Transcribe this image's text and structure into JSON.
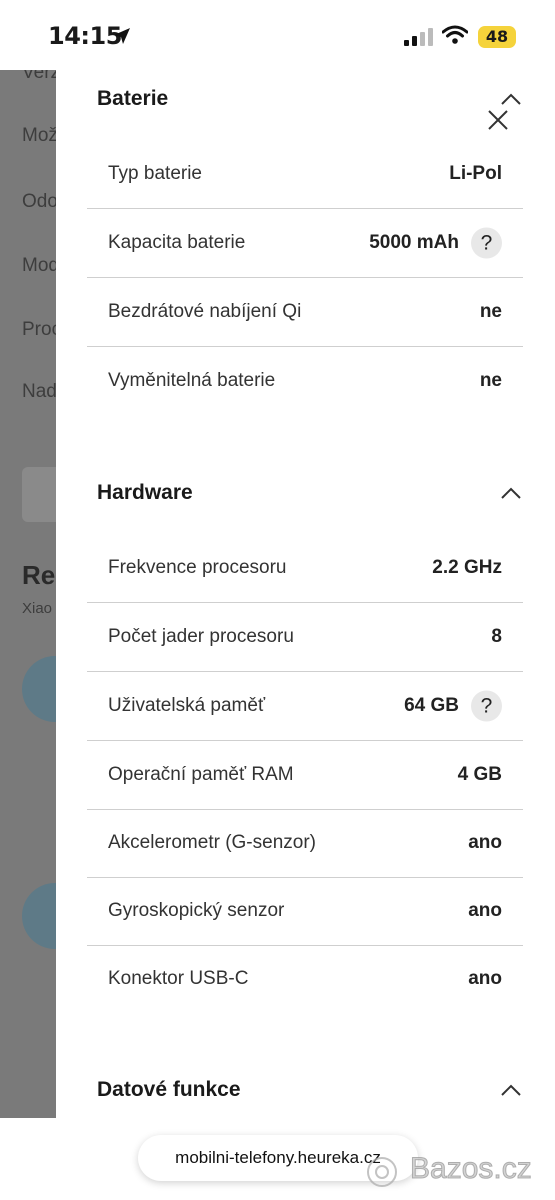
{
  "status_bar": {
    "time": "14:15",
    "battery": "48",
    "battery_color": "#f5d33b",
    "icons": [
      "location-arrow-icon",
      "signal-icon",
      "wifi-icon"
    ]
  },
  "background_page": {
    "side_texts": [
      "Verz",
      "Mož",
      "Odo",
      "Mod",
      "Proc",
      "Nad"
    ],
    "heading": "Re",
    "subtext": "Xiao"
  },
  "panel": {
    "sections": [
      {
        "title": "Baterie",
        "rows": [
          {
            "label": "Typ baterie",
            "value": "Li-Pol",
            "help": false
          },
          {
            "label": "Kapacita baterie",
            "value": "5000 mAh",
            "help": true
          },
          {
            "label": "Bezdrátové nabíjení Qi",
            "value": "ne",
            "help": false
          },
          {
            "label": "Vyměnitelná baterie",
            "value": "ne",
            "help": false
          }
        ]
      },
      {
        "title": "Hardware",
        "rows": [
          {
            "label": "Frekvence procesoru",
            "value": "2.2 GHz",
            "help": false
          },
          {
            "label": "Počet jader procesoru",
            "value": "8",
            "help": false
          },
          {
            "label": "Uživatelská paměť",
            "value": "64 GB",
            "help": true
          },
          {
            "label": "Operační paměť RAM",
            "value": "4 GB",
            "help": false
          },
          {
            "label": "Akcelerometr (G-senzor)",
            "value": "ano",
            "help": false
          },
          {
            "label": "Gyroskopický senzor",
            "value": "ano",
            "help": false
          },
          {
            "label": "Konektor USB-C",
            "value": "ano",
            "help": false
          }
        ]
      },
      {
        "title": "Datové funkce",
        "rows": []
      }
    ],
    "help_symbol": "?"
  },
  "browser": {
    "url": "mobilni-telefony.heureka.cz"
  },
  "watermark": {
    "text": "Bazos.cz"
  }
}
